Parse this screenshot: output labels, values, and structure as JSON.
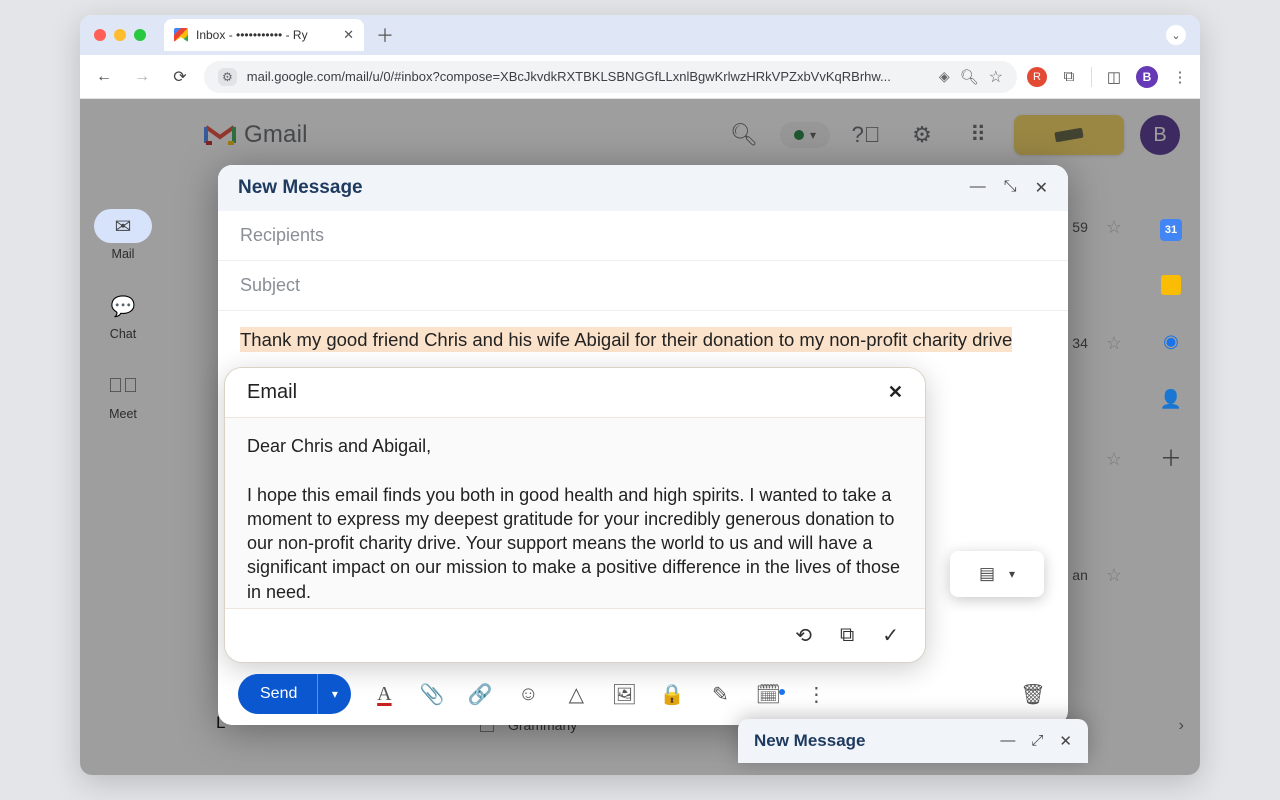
{
  "browser": {
    "tab_title": "Inbox - ••••••••••• - Ry",
    "url": "mail.google.com/mail/u/0/#inbox?compose=XBcJkvdkRXTBKLSBNGGfLLxnlBgwKrlwzHRkVPZxbVvKqRBrhw...",
    "profile_letter": "B"
  },
  "gmail": {
    "brand": "Gmail",
    "avatar_letter": "B",
    "calendar_day": "31",
    "nav": {
      "mail": "Mail",
      "chat": "Chat",
      "meet": "Meet"
    },
    "bg": {
      "time1": "59",
      "time2": "34",
      "time3": "an",
      "bottom_text": "Grammarly",
      "bottom_label_prefix": "L"
    }
  },
  "compose": {
    "window_title": "New Message",
    "recipients_placeholder": "Recipients",
    "subject_placeholder": "Subject",
    "highlight": "Thank my good friend Chris and his wife Abigail for their donation to my non-profit charity drive",
    "send_label": "Send"
  },
  "ai": {
    "heading": "Email",
    "body": "Dear Chris and Abigail,\n\nI hope this email finds you both in good health and high spirits. I wanted to take a moment to express my deepest gratitude for your incredibly generous donation to our non-profit charity drive. Your support means the world to us and will have a significant impact on our mission to make a positive difference in the lives of those in need.\n\nYour contribution will go directly towards providing essential resources, assistance"
  },
  "mini": {
    "title": "New Message"
  }
}
